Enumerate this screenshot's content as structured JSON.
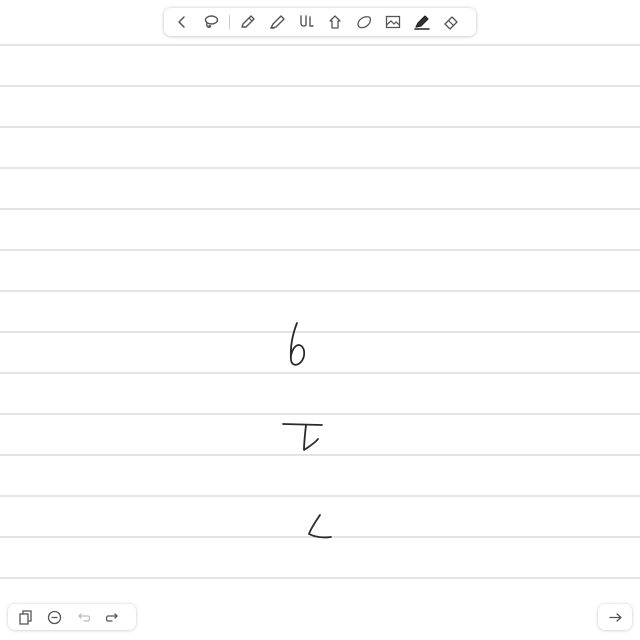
{
  "colors": {
    "rule_line": "#d4d4d4",
    "ink": "#2a2a2a",
    "icon": "#555555",
    "icon_disabled": "#bdbdbd"
  },
  "toolbar": {
    "items": [
      {
        "name": "back-chevron-icon"
      },
      {
        "name": "lasso-icon"
      },
      {
        "name": "pen-icon"
      },
      {
        "name": "highlighter-icon"
      },
      {
        "name": "shapes-icon"
      },
      {
        "name": "hand-icon"
      },
      {
        "name": "eraser-shape-icon"
      },
      {
        "name": "image-icon"
      },
      {
        "name": "marker-icon",
        "active": true
      },
      {
        "name": "eraser-icon"
      }
    ]
  },
  "bottom_bar": {
    "items": [
      {
        "name": "pages-icon"
      },
      {
        "name": "zoom-out-icon"
      },
      {
        "name": "undo-icon",
        "disabled": true
      },
      {
        "name": "redo-icon"
      }
    ],
    "next_page": {
      "name": "next-page-arrow-icon"
    }
  },
  "handwriting": {
    "strokes": [
      "b",
      "t",
      "c"
    ]
  }
}
